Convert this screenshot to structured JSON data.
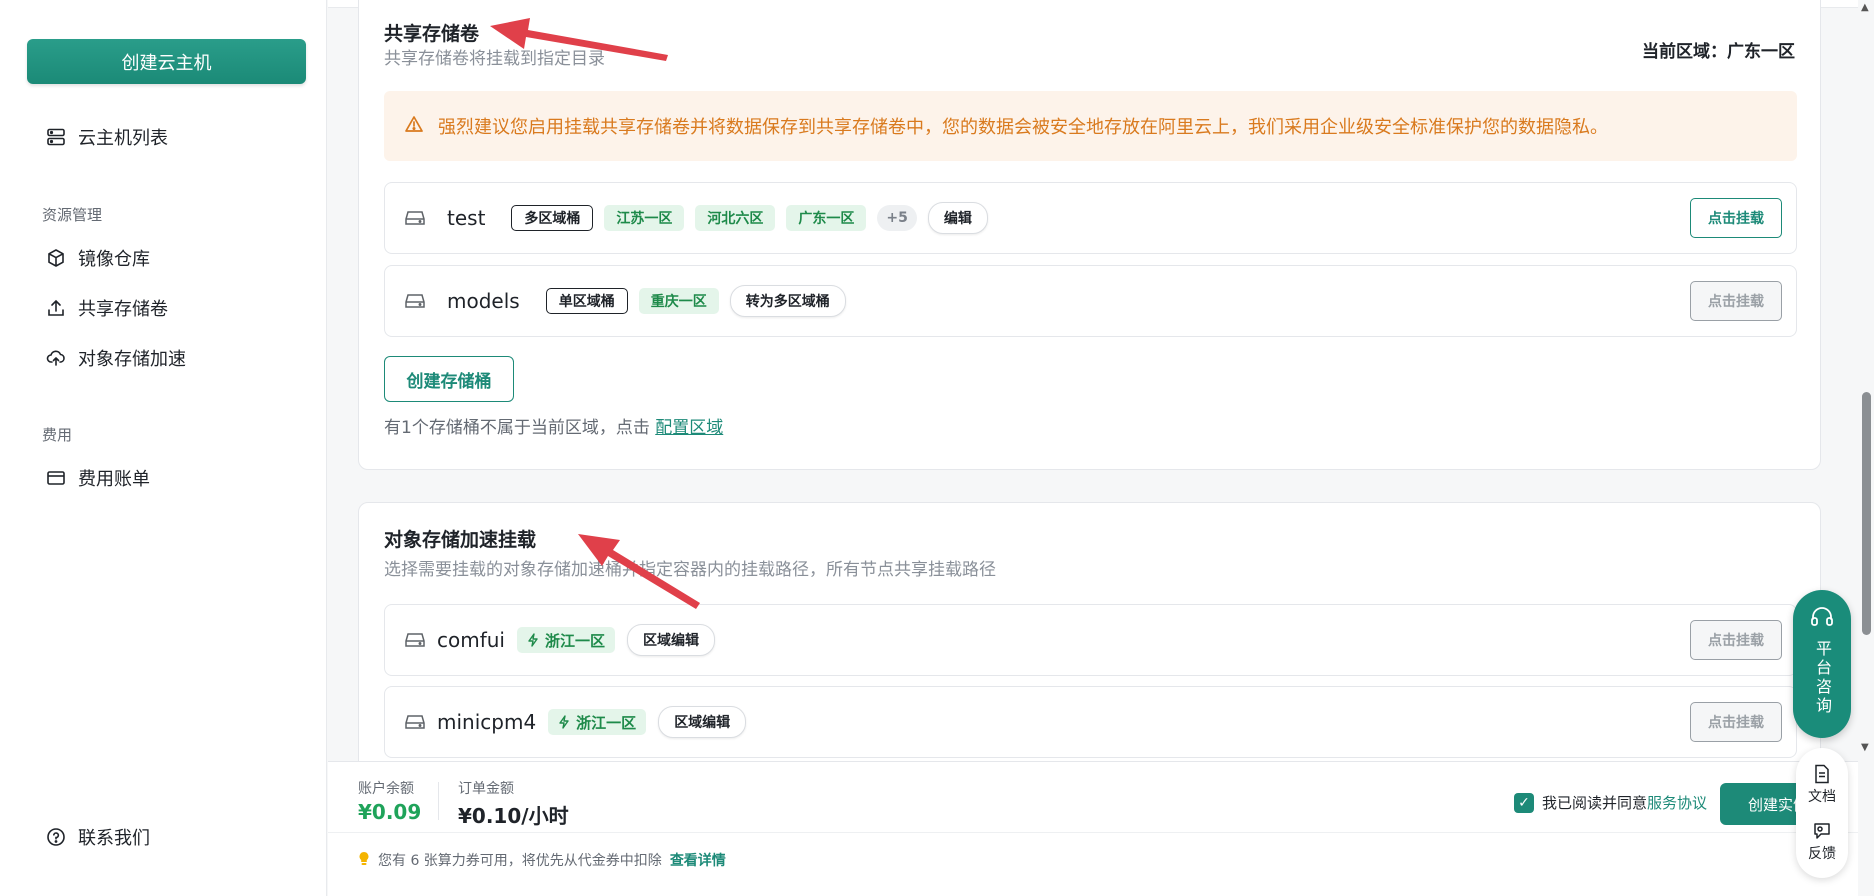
{
  "sidebar": {
    "create_button": "创建云主机",
    "items": [
      {
        "label": "云主机列表",
        "icon": "server-list-icon"
      },
      {
        "label": "镜像仓库",
        "icon": "cube-icon"
      },
      {
        "label": "共享存储卷",
        "icon": "upload-tray-icon"
      },
      {
        "label": "对象存储加速",
        "icon": "cloud-upload-icon"
      },
      {
        "label": "费用账单",
        "icon": "credit-card-icon"
      },
      {
        "label": "联系我们",
        "icon": "help-circle-icon"
      }
    ],
    "groups": [
      "资源管理",
      "费用"
    ]
  },
  "shared_volume": {
    "title": "共享存储卷",
    "subtitle": "共享存储卷将挂载到指定目录",
    "region_label": "当前区域：广东一区",
    "warning": "强烈建议您启用挂载共享存储卷并将数据保存到共享存储卷中，您的数据会被安全地存放在阿里云上，我们采用企业级安全标准保护您的数据隐私。",
    "buckets": [
      {
        "name": "test",
        "type_tag": "多区域桶",
        "regions": [
          "江苏一区",
          "河北六区",
          "广东一区"
        ],
        "more": "+5",
        "action_tag": "编辑",
        "mount": "点击挂载",
        "mount_enabled": true
      },
      {
        "name": "models",
        "type_tag": "单区域桶",
        "regions": [
          "重庆一区"
        ],
        "action_tag": "转为多区域桶",
        "mount": "点击挂载",
        "mount_enabled": false
      }
    ],
    "create_bucket": "创建存储桶",
    "note_text": "有1个存储桶不属于当前区域，点击",
    "note_link": "配置区域"
  },
  "object_storage": {
    "title": "对象存储加速挂载",
    "subtitle": "选择需要挂载的对象存储加速桶并指定容器内的挂载路径，所有节点共享挂载路径",
    "buckets": [
      {
        "name": "comfui",
        "zone": "浙江一区",
        "action": "区域编辑",
        "mount": "点击挂载"
      },
      {
        "name": "minicpm4",
        "zone": "浙江一区",
        "action": "区域编辑",
        "mount": "点击挂载"
      }
    ]
  },
  "bottom": {
    "balance_label": "账户余额",
    "balance_value": "¥0.09",
    "order_label": "订单金额",
    "order_value": "¥0.10/小时",
    "coupon_text": "您有 6 张算力券可用，将优先从代金券中扣除",
    "coupon_link": "查看详情",
    "agree_text": "我已阅读并同意",
    "agree_link": "服务协议",
    "create_instance": "创建实例"
  },
  "floating": {
    "consult": "平台咨询",
    "docs": "文档",
    "feedback": "反馈"
  },
  "colors": {
    "primary": "#1d8a78",
    "warning_bg": "#fdf3ea",
    "warning_text": "#d97a1e",
    "balance_green": "#1fa35a",
    "annotation_red": "#e0404a"
  }
}
